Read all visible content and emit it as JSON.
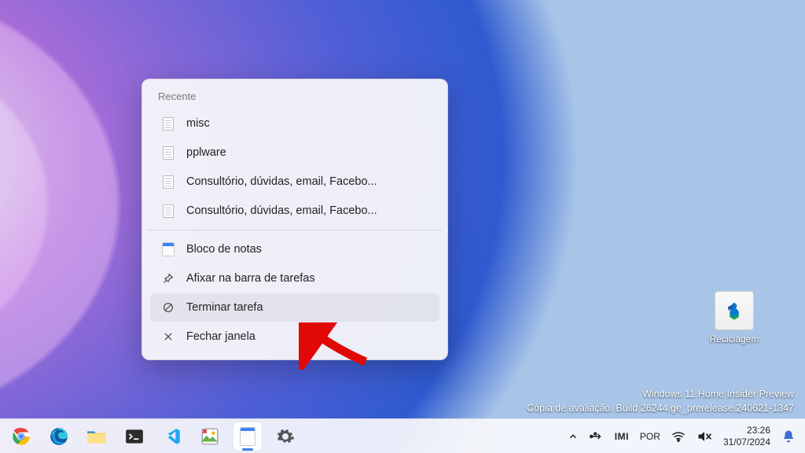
{
  "desktop": {
    "recycle_label": "Reciclagem"
  },
  "watermark": {
    "line1": "Windows 11 Home Insider Preview",
    "line2": "Cópia de avaliação. Build 26244.ge_prerelease.240621-1347"
  },
  "context_menu": {
    "section_title": "Recente",
    "recent": [
      "misc",
      "pplware",
      "Consultório, dúvidas, email, Facebo...",
      "Consultório, dúvidas, email, Facebo..."
    ],
    "actions": {
      "app_name": "Bloco de notas",
      "pin": "Afixar na barra de tarefas",
      "end_task": "Terminar tarefa",
      "close": "Fechar janela"
    }
  },
  "taskbar": {
    "apps": [
      "chrome",
      "edge",
      "explorer",
      "terminal",
      "vscode",
      "imaging",
      "notepad",
      "settings"
    ],
    "active_app": "notepad"
  },
  "tray": {
    "lang": "POR",
    "brand": "IMI",
    "time": "23:26",
    "date": "31/07/2024"
  }
}
